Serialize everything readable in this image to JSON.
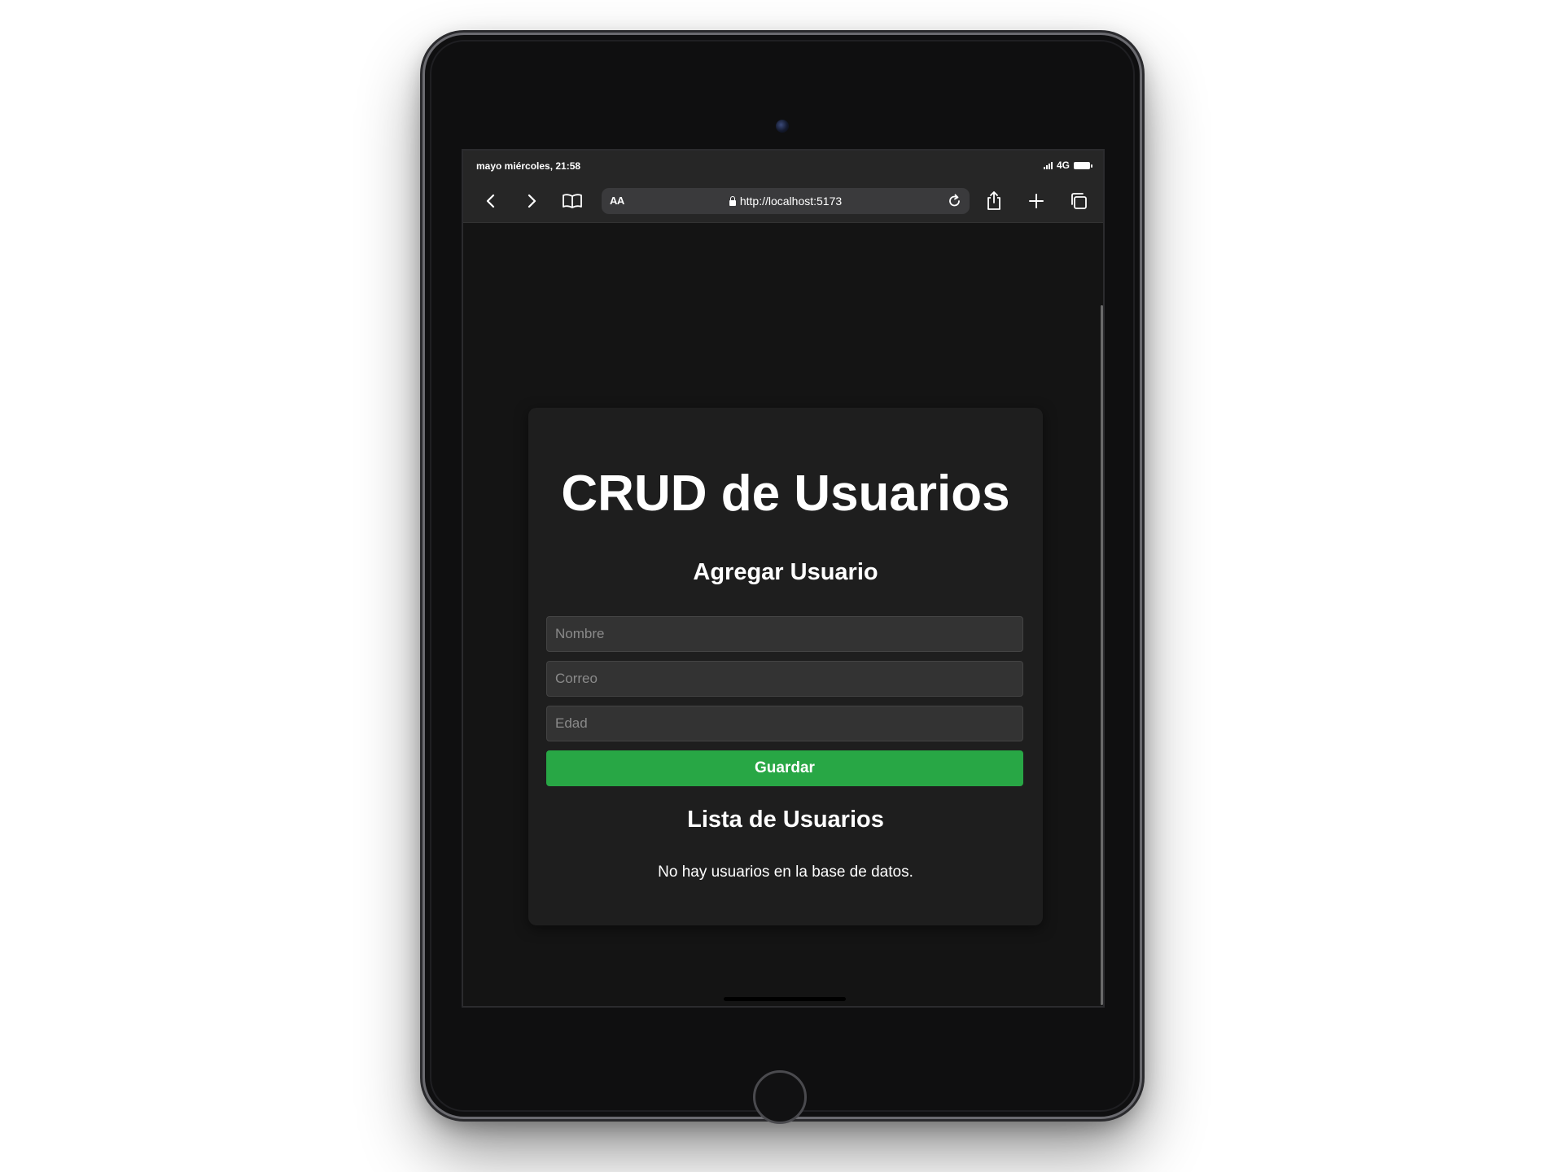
{
  "status_bar": {
    "time": "mayo miércoles, 21:58",
    "network": "4G"
  },
  "browser": {
    "text_size_label": "AA",
    "url": "http://localhost:5173"
  },
  "app": {
    "title": "CRUD de Usuarios",
    "add_section_title": "Agregar Usuario",
    "form": {
      "name_placeholder": "Nombre",
      "email_placeholder": "Correo",
      "age_placeholder": "Edad",
      "name_value": "",
      "email_value": "",
      "age_value": ""
    },
    "save_label": "Guardar",
    "list_section_title": "Lista de Usuarios",
    "empty_message": "No hay usuarios en la base de datos."
  },
  "colors": {
    "page_background": "#141414",
    "card_background": "#1e1e1e",
    "input_background": "#333333",
    "accent_green": "#28a745",
    "browser_chrome": "#262626"
  },
  "icons": {
    "toolbar": [
      "back-icon",
      "forward-icon",
      "bookmarks-icon",
      "lock-icon",
      "reload-icon",
      "share-icon",
      "new-tab-icon",
      "tabs-icon"
    ]
  }
}
